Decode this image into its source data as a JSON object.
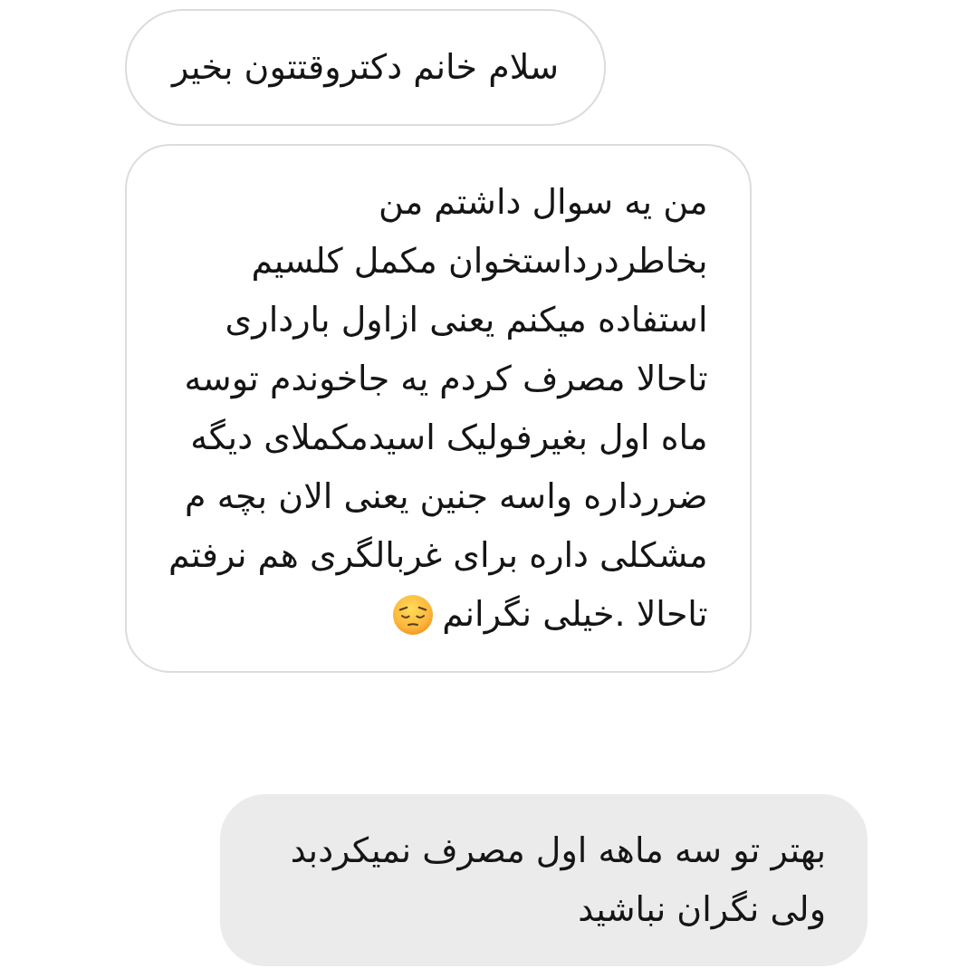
{
  "messages": [
    {
      "kind": "received",
      "lines": [
        "سلام خانم دکتروقتتون بخیر"
      ],
      "emoji": false
    },
    {
      "kind": "received",
      "lines": [
        "من یه سوال داشتم من",
        "بخاطردرداستخوان مکمل کلسیم",
        "استفاده میکنم یعنی ازاول بارداری",
        "تاحالا مصرف کردم یه جاخوندم توسه",
        "ماه اول بغیرفولیک اسیدمکملای دیگه",
        "ضررداره واسه جنین یعنی الان بچه م",
        "مشکلی داره برای غربالگری هم نرفتم",
        "تاحالا .خیلی نگرانم"
      ],
      "emoji": true
    },
    {
      "kind": "sent",
      "lines": [
        "بهتر تو سه ماهه اول مصرف نمیکردبد",
        "ولی نگران نباشید"
      ],
      "emoji": false
    }
  ]
}
